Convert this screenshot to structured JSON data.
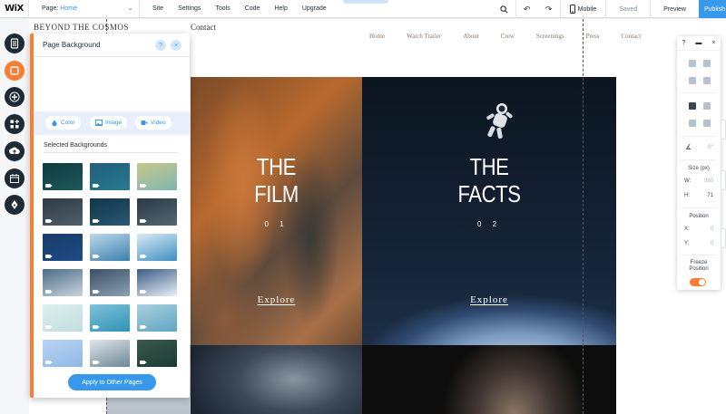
{
  "topbar": {
    "logo": "WiX",
    "page_label": "Page:",
    "page_value": "Home",
    "menus": [
      "Site",
      "Settings",
      "Tools",
      "Code",
      "Help",
      "Upgrade"
    ],
    "mobile_label": "Mobile",
    "saved_label": "Saved",
    "preview_label": "Preview",
    "publish_label": "Publish"
  },
  "site": {
    "title": "BEYOND THE COSMOS",
    "subtitle": "Contact",
    "nav": [
      "Home",
      "Watch Trailer",
      "About",
      "Crew",
      "Screenings",
      "Press",
      "Contact"
    ],
    "tiles": [
      {
        "line1": "THE",
        "line2": "FILM",
        "number": "0 1",
        "link": "Explore"
      },
      {
        "line1": "THE",
        "line2": "FACTS",
        "number": "0 2",
        "link": "Explore"
      }
    ]
  },
  "panel": {
    "title": "Page Background",
    "help_label": "?",
    "close_label": "×",
    "types": [
      "Color",
      "Image",
      "Video"
    ],
    "selected_label": "Selected Backgrounds",
    "apply_label": "Apply to Other Pages"
  },
  "thumbs": [
    {
      "top": "#0f3a3f",
      "bottom": "#1d5a5c",
      "video": true
    },
    {
      "top": "#1f5f7a",
      "bottom": "#2b7892",
      "video": true
    },
    {
      "top": "#c6c98a",
      "bottom": "#7fb6b0",
      "video": true
    },
    {
      "top": "#2e3a44",
      "bottom": "#50606c",
      "video": true
    },
    {
      "top": "#13344a",
      "bottom": "#285a74",
      "video": true
    },
    {
      "top": "#2a3a45",
      "bottom": "#536773",
      "video": true
    },
    {
      "top": "#173c6a",
      "bottom": "#1e4c84",
      "video": true
    },
    {
      "top": "#bcd9ea",
      "bottom": "#3b7fae",
      "video": true
    },
    {
      "top": "#d8ebf6",
      "bottom": "#3f8ec0",
      "video": true
    },
    {
      "top": "#4b6c86",
      "bottom": "#c9d4de",
      "video": true
    },
    {
      "top": "#3c4f66",
      "bottom": "#8aa0b4",
      "video": true
    },
    {
      "top": "#3a5a86",
      "bottom": "#e9f1f7",
      "video": true
    },
    {
      "top": "#dfeeee",
      "bottom": "#bfdede",
      "video": true
    },
    {
      "top": "#7fc2d8",
      "bottom": "#2f93b6",
      "video": true
    },
    {
      "top": "#a9d0df",
      "bottom": "#5fa5c3",
      "video": true
    },
    {
      "top": "#b9d4f2",
      "bottom": "#8fb8e6",
      "video": true
    },
    {
      "top": "#dfe6ea",
      "bottom": "#6d8696",
      "video": true
    },
    {
      "top": "#3b5a4c",
      "bottom": "#1b3a33",
      "video": true
    }
  ],
  "inspector": {
    "help_label": "?",
    "angle_value": "0°",
    "size_label": "Size (px)",
    "w_label": "W:",
    "w_value": "980",
    "h_label": "H:",
    "h_value": "71",
    "position_label": "Position",
    "x_label": "X:",
    "x_value": "0",
    "y_label": "Y:",
    "y_value": "0",
    "freeze_label": "Freeze Position",
    "freeze_on": true
  },
  "colors": {
    "accent": "#3899ec",
    "active_rail": "#fb7d33",
    "rail_button": "#1e2a36"
  },
  "icons": {
    "rail": [
      "pages-icon",
      "background-icon",
      "add-icon",
      "add-apps-icon",
      "upload-icon",
      "blog-icon",
      "pen-icon"
    ],
    "top_right": [
      "zoom-icon",
      "undo-icon",
      "redo-icon",
      "mobile-icon"
    ]
  }
}
